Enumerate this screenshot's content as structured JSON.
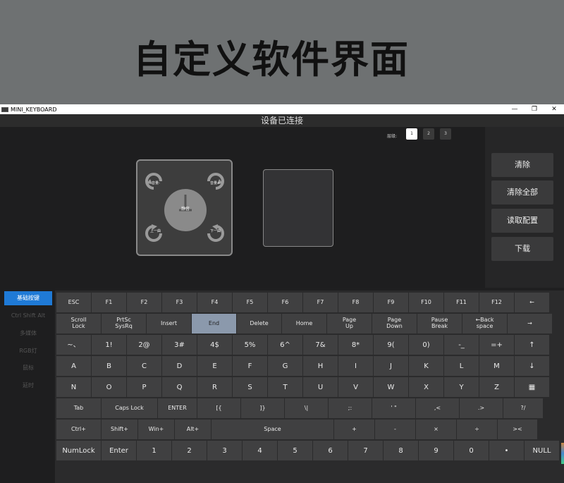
{
  "banner": {
    "title": "自定义软件界面"
  },
  "window": {
    "title": "MINI_KEYBOARD",
    "controls": [
      "—",
      "❐",
      "✕"
    ],
    "status": "设备已连接"
  },
  "layers": {
    "label": "层级:",
    "items": [
      "1",
      "2",
      "3"
    ],
    "active": "1"
  },
  "knob": {
    "center_label": "静音",
    "top_left": "音量-",
    "top_right": "音量+",
    "bottom_left": "上一曲",
    "bottom_right": "下一曲"
  },
  "actions": [
    "清除",
    "清除全部",
    "读取配置",
    "下载"
  ],
  "side_nav": [
    "基础按键",
    "Ctrl Shift Alt",
    "多媒体",
    "RGB灯",
    "鼠标",
    "延时"
  ],
  "keyboard": {
    "selected": "End",
    "rows": [
      [
        "ESC",
        "F1",
        "F2",
        "F3",
        "F4",
        "F5",
        "F6",
        "F7",
        "F8",
        "F9",
        "F10",
        "F11",
        "F12",
        "←"
      ],
      [
        "Scroll\nLock",
        "PrtSc\nSysRq",
        "Insert",
        "End",
        "Delete",
        "Home",
        "Page\nUp",
        "Page\nDown",
        "Pause\nBreak",
        "←Back\nspace",
        "→"
      ],
      [
        "~、",
        "1!",
        "2@",
        "3#",
        "4$",
        "5%",
        "6^",
        "7&",
        "8*",
        "9(",
        "0)",
        "-_",
        "=+",
        "↑"
      ],
      [
        "A",
        "B",
        "C",
        "D",
        "E",
        "F",
        "G",
        "H",
        "I",
        "J",
        "K",
        "L",
        "M",
        "↓"
      ],
      [
        "N",
        "O",
        "P",
        "Q",
        "R",
        "S",
        "T",
        "U",
        "V",
        "W",
        "X",
        "Y",
        "Z",
        "▦"
      ],
      [
        "Tab",
        "Caps Lock",
        "ENTER",
        "[{",
        "]}",
        "\\|",
        ";:",
        "' \"",
        ",<",
        ".>",
        "?/"
      ],
      [
        "Ctrl+",
        "Shift+",
        "Win+",
        "Alt+",
        "Space",
        "+",
        "-",
        "×",
        "÷",
        "><"
      ],
      [
        "NumLock",
        "Enter",
        "1",
        "2",
        "3",
        "4",
        "5",
        "6",
        "7",
        "8",
        "9",
        "0",
        "•",
        "NULL"
      ]
    ]
  }
}
